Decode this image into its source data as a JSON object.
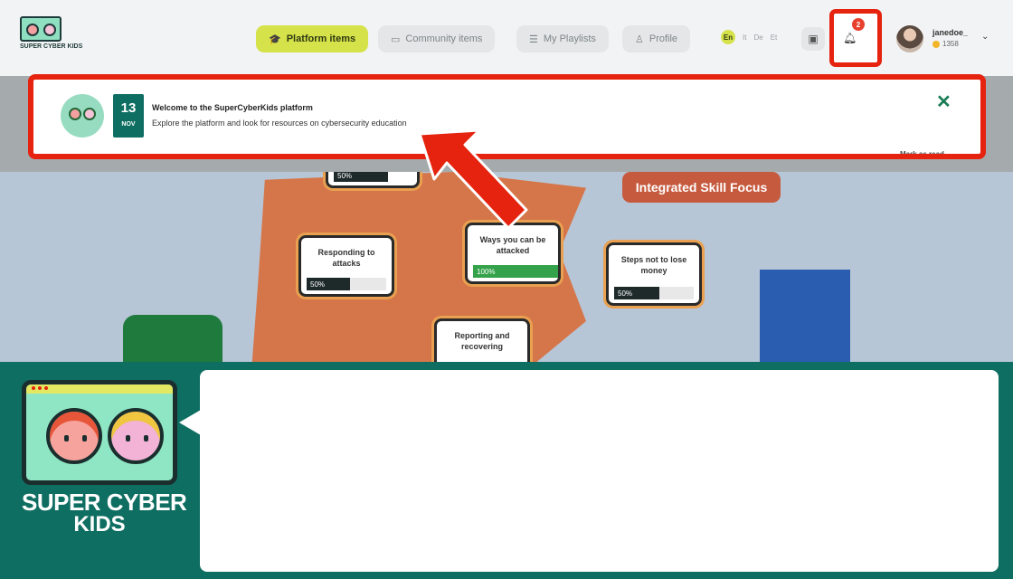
{
  "header": {
    "logo_text": "SUPER CYBER KIDS",
    "nav": [
      {
        "label": "Platform items",
        "icon": "graduation-cap-icon",
        "active": true
      },
      {
        "label": "Community items",
        "icon": "folder-icon",
        "active": false
      },
      {
        "label": "My Playlists",
        "icon": "playlist-icon",
        "active": false
      },
      {
        "label": "Profile",
        "icon": "person-icon",
        "active": false
      }
    ],
    "languages": [
      "En",
      "It",
      "De",
      "Et"
    ],
    "notification_count": "2",
    "user": {
      "name": "janedoe_",
      "coins": "1358"
    }
  },
  "notification": {
    "date_day": "13",
    "date_month": "NOV",
    "title": "Welcome to the SuperCyberKids platform",
    "body": "Explore the platform and look for resources on cybersecurity education",
    "mark_read": "Mark as read"
  },
  "map": {
    "section_tag": "Integrated Skill Focus",
    "cards": [
      {
        "title": "",
        "progress": "50%"
      },
      {
        "title": "Responding to attacks",
        "progress": "50%"
      },
      {
        "title": "Ways you can be attacked",
        "progress": "100%"
      },
      {
        "title": "Steps not to lose money",
        "progress": "50%"
      },
      {
        "title": "Reporting and recovering",
        "progress": ""
      }
    ]
  },
  "footer": {
    "brand_line1": "SUPER CYBER",
    "brand_line2": "KIDS"
  },
  "colors": {
    "accent_lime": "#d6e24a",
    "highlight_red": "#e5230f",
    "teal": "#0f6e62",
    "badge_red": "#e8402f"
  }
}
